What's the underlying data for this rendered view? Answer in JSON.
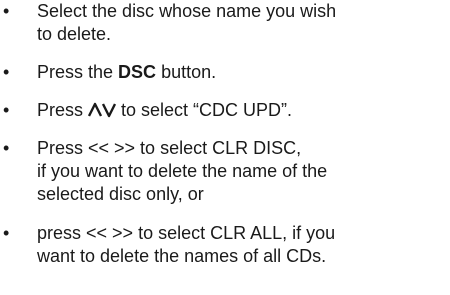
{
  "instructions": {
    "bullet": "•",
    "step1": {
      "line1": "Select the disc whose name you wish",
      "line2": "to delete."
    },
    "step2": {
      "pre": "Press the ",
      "bold": "DSC",
      "post": " button."
    },
    "step3": {
      "pre": "Press ",
      "icon": "up-down-arrows-icon",
      "post": " to select “CDC UPD”."
    },
    "step4": {
      "line1": "Press << >> to select CLR DISC,",
      "line2": "if you want to delete the name of the",
      "line3": "selected disc only, or"
    },
    "step5": {
      "line1": "press << >> to select CLR ALL, if you",
      "line2": "want to delete the names of all CDs."
    }
  }
}
